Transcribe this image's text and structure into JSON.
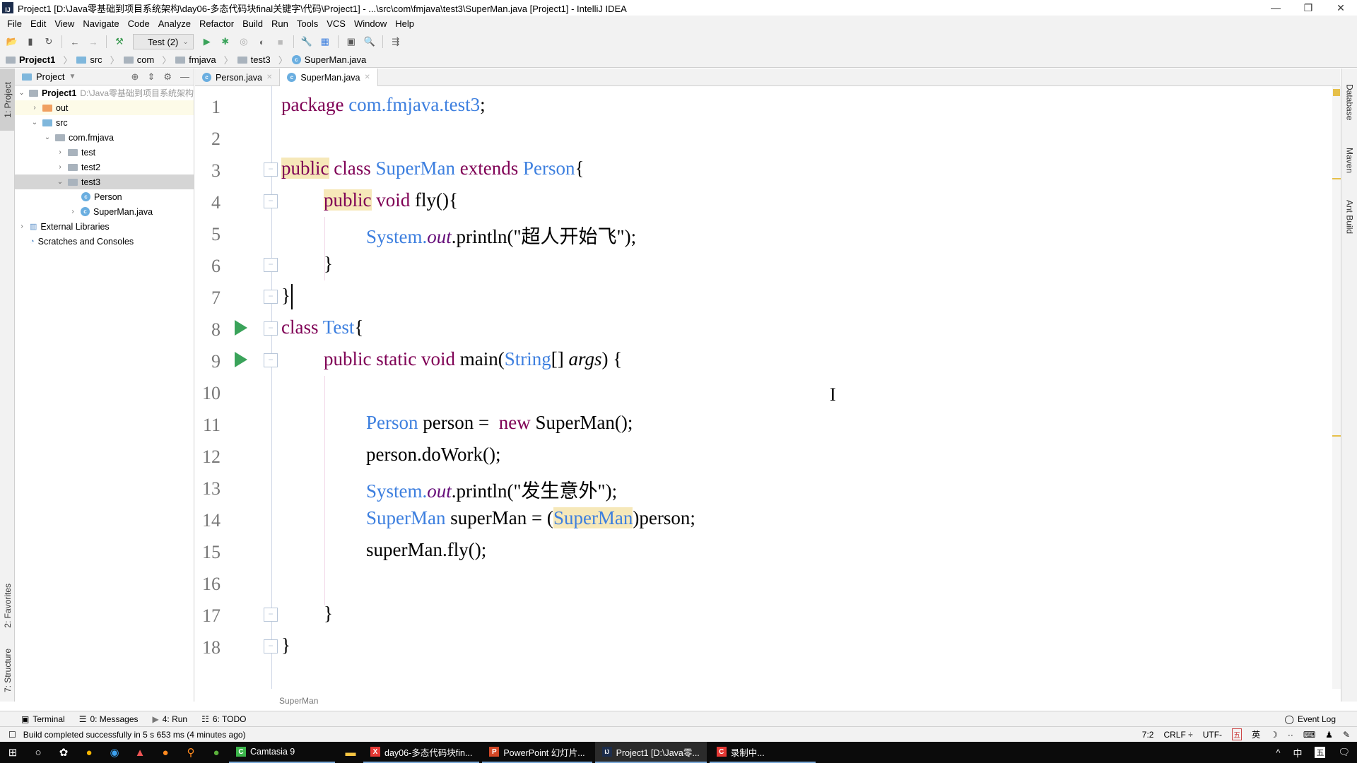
{
  "window": {
    "title": "Project1 [D:\\Java零基础到项目系统架构\\day06-多态代码块final关键字\\代码\\Project1] - ...\\src\\com\\fmjava\\test3\\SuperMan.java [Project1] - IntelliJ IDEA",
    "app_icon": "IJ",
    "minimize": "—",
    "restore": "❐",
    "close": "✕"
  },
  "menu": [
    "File",
    "Edit",
    "View",
    "Navigate",
    "Code",
    "Analyze",
    "Refactor",
    "Build",
    "Run",
    "Tools",
    "VCS",
    "Window",
    "Help"
  ],
  "toolbar": {
    "run_config": "Test (2)",
    "icons": [
      "open-icon",
      "save-icon",
      "sync-icon",
      "back-icon",
      "forward-icon",
      "build-hammer-icon",
      "run-icon",
      "debug-icon",
      "coverage-icon",
      "profile-icon",
      "stop-icon",
      "settings-wrench-icon",
      "project-structure-icon",
      "sdk-icon",
      "search-icon",
      "vcs-icon"
    ]
  },
  "navbar": {
    "crumbs": [
      "Project1",
      "src",
      "com",
      "fmjava",
      "test3",
      "SuperMan.java"
    ]
  },
  "left_strip": {
    "project": "1: Project",
    "favorites": "2: Favorites",
    "structure": "7: Structure"
  },
  "project_panel": {
    "header": "Project",
    "tree": [
      {
        "label": "Project1",
        "path": "D:\\Java零基础到项目系统架构",
        "expanded": true,
        "level": 0,
        "bold": true
      },
      {
        "label": "out",
        "level": 1,
        "expanded": false
      },
      {
        "label": "src",
        "level": 1,
        "expanded": true
      },
      {
        "label": "com.fmjava",
        "level": 2,
        "expanded": true
      },
      {
        "label": "test",
        "level": 3,
        "expanded": false
      },
      {
        "label": "test2",
        "level": 3,
        "expanded": false
      },
      {
        "label": "test3",
        "level": 3,
        "expanded": true,
        "selected": true
      },
      {
        "label": "Person",
        "level": 4
      },
      {
        "label": "SuperMan.java",
        "level": 4,
        "expanded": false
      },
      {
        "label": "External Libraries",
        "level": 0,
        "expanded": false
      },
      {
        "label": "Scratches and Consoles",
        "level": 0
      }
    ]
  },
  "tabs": [
    {
      "label": "Person.java",
      "active": false
    },
    {
      "label": "SuperMan.java",
      "active": true
    }
  ],
  "editor": {
    "line_numbers": [
      "1",
      "2",
      "3",
      "4",
      "5",
      "6",
      "7",
      "8",
      "9",
      "10",
      "11",
      "12",
      "13",
      "14",
      "15",
      "16",
      "17",
      "18"
    ],
    "lines": {
      "l1": {
        "kw": "package",
        "pkg": "com.fmjava.test3",
        "semi": ";"
      },
      "l3": {
        "kw1": "public",
        "kw2": "class",
        "name": "SuperMan",
        "kw3": "extends",
        "parent": "Person",
        "brace": "{"
      },
      "l4": {
        "kw1": "public",
        "kw2": "void",
        "rest": "fly(){"
      },
      "l5": {
        "sys": "System.",
        "out": "out",
        "rest": ".println(",
        "str": "\"超人开始飞\"",
        "end": ");"
      },
      "l6": {
        "text": "}"
      },
      "l7": {
        "text": "}"
      },
      "l8": {
        "kw": "class",
        "name": "Test",
        "brace": "{"
      },
      "l9": {
        "kw1": "public",
        "kw2": "static",
        "kw3": "void",
        "m": "main(",
        "type": "String",
        "arr": "[] ",
        "arg": "args",
        "end": ") {"
      },
      "l11": {
        "type": "Person",
        "var": " person = ",
        "kw": "new",
        "rest": " SuperMan();"
      },
      "l12": {
        "text": "person.doWork();"
      },
      "l13": {
        "sys": "System.",
        "out": "out",
        "rest": ".println(",
        "str": "\"发生意外\"",
        "end": ");"
      },
      "l14": {
        "type": "SuperMan",
        "var": " superMan = (",
        "cast": "SuperMan",
        "rest": ")person;"
      },
      "l15": {
        "text": "superMan.fly();"
      },
      "l17": {
        "text": "}"
      },
      "l18": {
        "text": "}"
      }
    },
    "breadcrumb": "SuperMan"
  },
  "right_strip": [
    "Database",
    "Maven",
    "Ant Build"
  ],
  "tool_windows": [
    {
      "label": "Terminal",
      "icon": "terminal-icon"
    },
    {
      "label": "0: Messages",
      "icon": "messages-icon"
    },
    {
      "label": "4: Run",
      "icon": "run-icon"
    },
    {
      "label": "6: TODO",
      "icon": "todo-icon"
    }
  ],
  "event_log": "Event Log",
  "status": {
    "message": "Build completed successfully in 5 s 653 ms (4 minutes ago)",
    "position": "7:2",
    "line_sep": "CRLF ÷",
    "encoding": "UTF-",
    "ime": [
      "五",
      "英",
      "☽",
      "··",
      "⌨",
      "♟",
      "✎"
    ]
  },
  "taskbar": {
    "tasks": [
      {
        "label": "Camtasia 9",
        "icon": "C",
        "color": "#3bb54a"
      },
      {
        "label": "day06-多态代码块fin...",
        "icon": "X",
        "color": "#e53935"
      },
      {
        "label": "PowerPoint 幻灯片...",
        "icon": "P",
        "color": "#d24726"
      },
      {
        "label": "Project1 [D:\\Java零...",
        "icon": "IJ",
        "color": "#1c2d4c",
        "active": true
      },
      {
        "label": "录制中...",
        "icon": "C",
        "color": "#e53935"
      }
    ],
    "tray": [
      "^",
      "中",
      "五",
      "🗨"
    ]
  }
}
